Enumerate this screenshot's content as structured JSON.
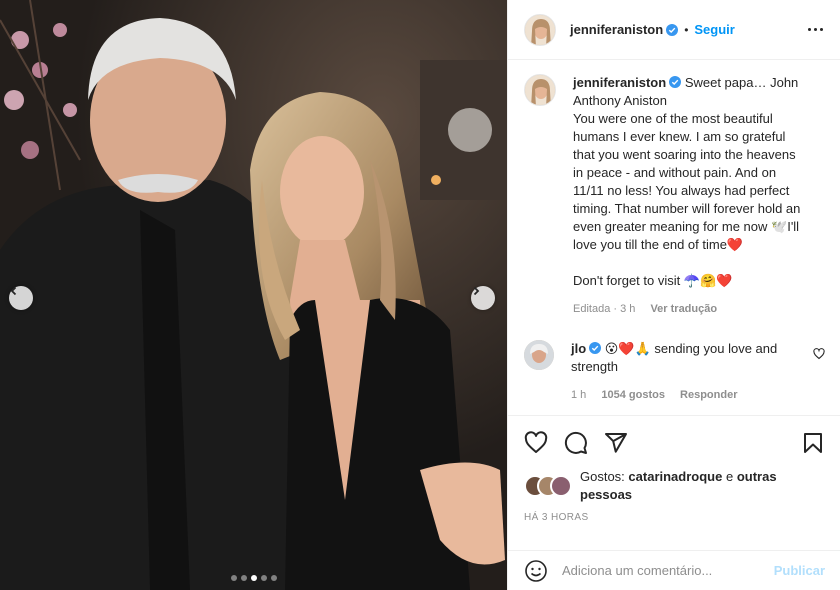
{
  "post": {
    "carousel": {
      "slide_count": 5,
      "active_index": 2,
      "prev_icon": "chevron-left-icon",
      "next_icon": "chevron-right-icon"
    }
  },
  "header": {
    "username": "jenniferaniston",
    "separator": "•",
    "follow_label": "Seguir",
    "more_icon": "ellipsis-icon"
  },
  "caption": {
    "username": "jenniferaniston",
    "text": "Sweet papa… John Anthony Aniston\nYou were one of the most beautiful humans I ever knew. I am so grateful that you went soaring into the heavens in peace - and without pain. And on 11/11 no less! You always had perfect timing. That number will forever hold an even greater meaning for me now",
    "text_end": "I'll love you till the end of time",
    "text_last": "Don't forget to visit",
    "edited": "Editada · 3 h",
    "translate": "Ver tradução"
  },
  "comment": {
    "username": "jlo",
    "emojis": "😮❤️🙏",
    "text": "sending you love and strength",
    "time": "1 h",
    "likes": "1054 gostos",
    "reply": "Responder"
  },
  "actions": {
    "icons": [
      "heart-icon",
      "comment-icon",
      "share-icon",
      "bookmark-icon"
    ],
    "likes_prefix": "Gostos:",
    "likes_user": "catarinadroque",
    "likes_and": "e",
    "likes_others": "outras pessoas",
    "time_ago": "HÁ 3 HORAS"
  },
  "add_comment": {
    "placeholder": "Adiciona um comentário...",
    "publish_label": "Publicar",
    "emoji_icon": "smiley-icon"
  },
  "colors": {
    "accent": "#0095f6",
    "publish_disabled": "#b2dffc",
    "verified": "#3897f0",
    "heart": "#ed4956",
    "muted": "#8e8e8e"
  }
}
